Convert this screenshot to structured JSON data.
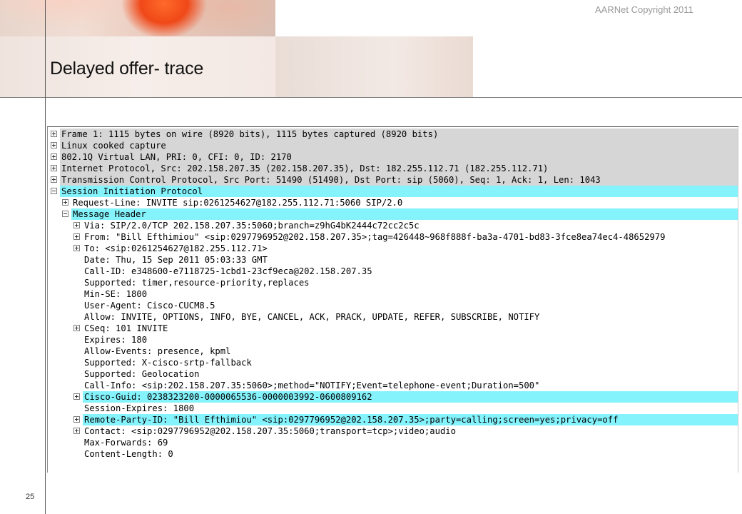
{
  "slide": {
    "title": "Delayed offer- trace",
    "copyright": "AARNet Copyright 2011",
    "page_number": "25"
  },
  "packet_tree": {
    "rows": [
      {
        "text": "Frame 1: 1115 bytes on wire (8920 bits), 1115 bytes captured (8920 bits)",
        "toggle": "plus",
        "level": 0,
        "highlight": "grey"
      },
      {
        "text": "Linux cooked capture",
        "toggle": "plus",
        "level": 0,
        "highlight": "grey"
      },
      {
        "text": "802.1Q Virtual LAN, PRI: 0, CFI: 0, ID: 2170",
        "toggle": "plus",
        "level": 0,
        "highlight": "grey"
      },
      {
        "text": "Internet Protocol, Src: 202.158.207.35 (202.158.207.35), Dst: 182.255.112.71 (182.255.112.71)",
        "toggle": "plus",
        "level": 0,
        "highlight": "grey"
      },
      {
        "text": "Transmission Control Protocol, Src Port: 51490 (51490), Dst Port: sip (5060), Seq: 1, Ack: 1, Len: 1043",
        "toggle": "plus",
        "level": 0,
        "highlight": "grey"
      },
      {
        "text": "Session Initiation Protocol",
        "toggle": "minus",
        "level": 0,
        "highlight": "cyan"
      },
      {
        "text": "Request-Line: INVITE sip:0261254627@182.255.112.71:5060 SIP/2.0",
        "toggle": "plus",
        "level": 1,
        "highlight": "none"
      },
      {
        "text": "Message Header",
        "toggle": "minus",
        "level": 1,
        "highlight": "cyan"
      },
      {
        "text": "Via: SIP/2.0/TCP 202.158.207.35:5060;branch=z9hG4bK2444c72cc2c5c",
        "toggle": "plus",
        "level": 2,
        "highlight": "none"
      },
      {
        "text": "From: \"Bill Efthimiou\" <sip:0297796952@202.158.207.35>;tag=426448~968f888f-ba3a-4701-bd83-3fce8ea74ec4-48652979",
        "toggle": "plus",
        "level": 2,
        "highlight": "none"
      },
      {
        "text": "To: <sip:0261254627@182.255.112.71>",
        "toggle": "plus",
        "level": 2,
        "highlight": "none"
      },
      {
        "text": "Date: Thu, 15 Sep 2011 05:03:33 GMT",
        "toggle": "none",
        "level": 2,
        "highlight": "none"
      },
      {
        "text": "Call-ID: e348600-e7118725-1cbd1-23cf9eca@202.158.207.35",
        "toggle": "none",
        "level": 2,
        "highlight": "none"
      },
      {
        "text": "Supported: timer,resource-priority,replaces",
        "toggle": "none",
        "level": 2,
        "highlight": "none"
      },
      {
        "text": "Min-SE:  1800",
        "toggle": "none",
        "level": 2,
        "highlight": "none"
      },
      {
        "text": "User-Agent: Cisco-CUCM8.5",
        "toggle": "none",
        "level": 2,
        "highlight": "none"
      },
      {
        "text": "Allow: INVITE, OPTIONS, INFO, BYE, CANCEL, ACK, PRACK, UPDATE, REFER, SUBSCRIBE, NOTIFY",
        "toggle": "none",
        "level": 2,
        "highlight": "none"
      },
      {
        "text": "CSeq: 101 INVITE",
        "toggle": "plus",
        "level": 2,
        "highlight": "none"
      },
      {
        "text": "Expires: 180",
        "toggle": "none",
        "level": 2,
        "highlight": "none"
      },
      {
        "text": "Allow-Events: presence, kpml",
        "toggle": "none",
        "level": 2,
        "highlight": "none"
      },
      {
        "text": "Supported: X-cisco-srtp-fallback",
        "toggle": "none",
        "level": 2,
        "highlight": "none"
      },
      {
        "text": "Supported: Geolocation",
        "toggle": "none",
        "level": 2,
        "highlight": "none"
      },
      {
        "text": "Call-Info: <sip:202.158.207.35:5060>;method=\"NOTIFY;Event=telephone-event;Duration=500\"",
        "toggle": "none",
        "level": 2,
        "highlight": "none"
      },
      {
        "text": "Cisco-Guid: 0238323200-0000065536-0000003992-0600809162",
        "toggle": "plus",
        "level": 2,
        "highlight": "cyan"
      },
      {
        "text": "Session-Expires:  1800",
        "toggle": "none",
        "level": 2,
        "highlight": "none"
      },
      {
        "text": "Remote-Party-ID: \"Bill Efthimiou\" <sip:0297796952@202.158.207.35>;party=calling;screen=yes;privacy=off",
        "toggle": "plus",
        "level": 2,
        "highlight": "cyan"
      },
      {
        "text": "Contact: <sip:0297796952@202.158.207.35:5060;transport=tcp>;video;audio",
        "toggle": "plus",
        "level": 2,
        "highlight": "none"
      },
      {
        "text": "Max-Forwards: 69",
        "toggle": "none",
        "level": 2,
        "highlight": "none"
      },
      {
        "text": "Content-Length: 0",
        "toggle": "none",
        "level": 2,
        "highlight": "none"
      }
    ]
  }
}
